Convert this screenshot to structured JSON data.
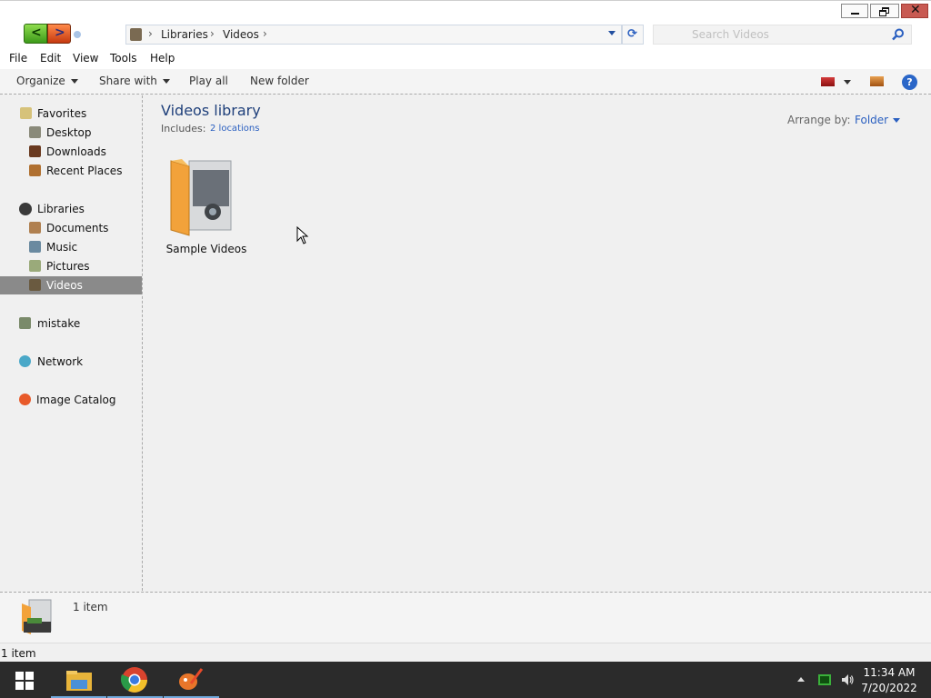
{
  "window": {
    "minimize_icon": "minimize-icon",
    "restore_icon": "restore-icon",
    "close_icon": "close-icon",
    "close_color": "#c85a52"
  },
  "navigation": {
    "back_icon": "back-arrow-icon",
    "forward_icon": "forward-arrow-icon",
    "breadcrumbs": [
      "Libraries",
      "Videos"
    ],
    "search_placeholder": "Search Videos"
  },
  "menu": {
    "items": [
      "File",
      "Edit",
      "View",
      "Tools",
      "Help"
    ]
  },
  "toolbar": {
    "organize": "Organize",
    "share_with": "Share with",
    "play_all": "Play all",
    "new_folder": "New folder",
    "help_glyph": "?"
  },
  "sidebar": {
    "favorites": {
      "label": "Favorites",
      "items": [
        "Desktop",
        "Downloads",
        "Recent Places"
      ]
    },
    "libraries": {
      "label": "Libraries",
      "items": [
        "Documents",
        "Music",
        "Pictures",
        "Videos"
      ],
      "selected": "Videos"
    },
    "homegroup": "mistake",
    "network": "Network",
    "image_catalog": "Image Catalog",
    "selection_color": "#8a8a8a"
  },
  "content": {
    "library_title": "Videos library",
    "includes_label": "Includes:",
    "includes_link": "2 locations",
    "arrange_label": "Arrange by:",
    "arrange_value": "Folder",
    "items": [
      {
        "name": "Sample Videos",
        "icon": "video-folder-icon"
      }
    ],
    "title_color": "#1e3f7a",
    "link_color": "#2a5fc0"
  },
  "details": {
    "count": "1 item"
  },
  "status": {
    "count": "1 item"
  },
  "taskbar": {
    "apps": [
      "file-explorer-icon",
      "chrome-icon",
      "paint-icon"
    ],
    "time": "11:34 AM",
    "date": "7/20/2022"
  }
}
